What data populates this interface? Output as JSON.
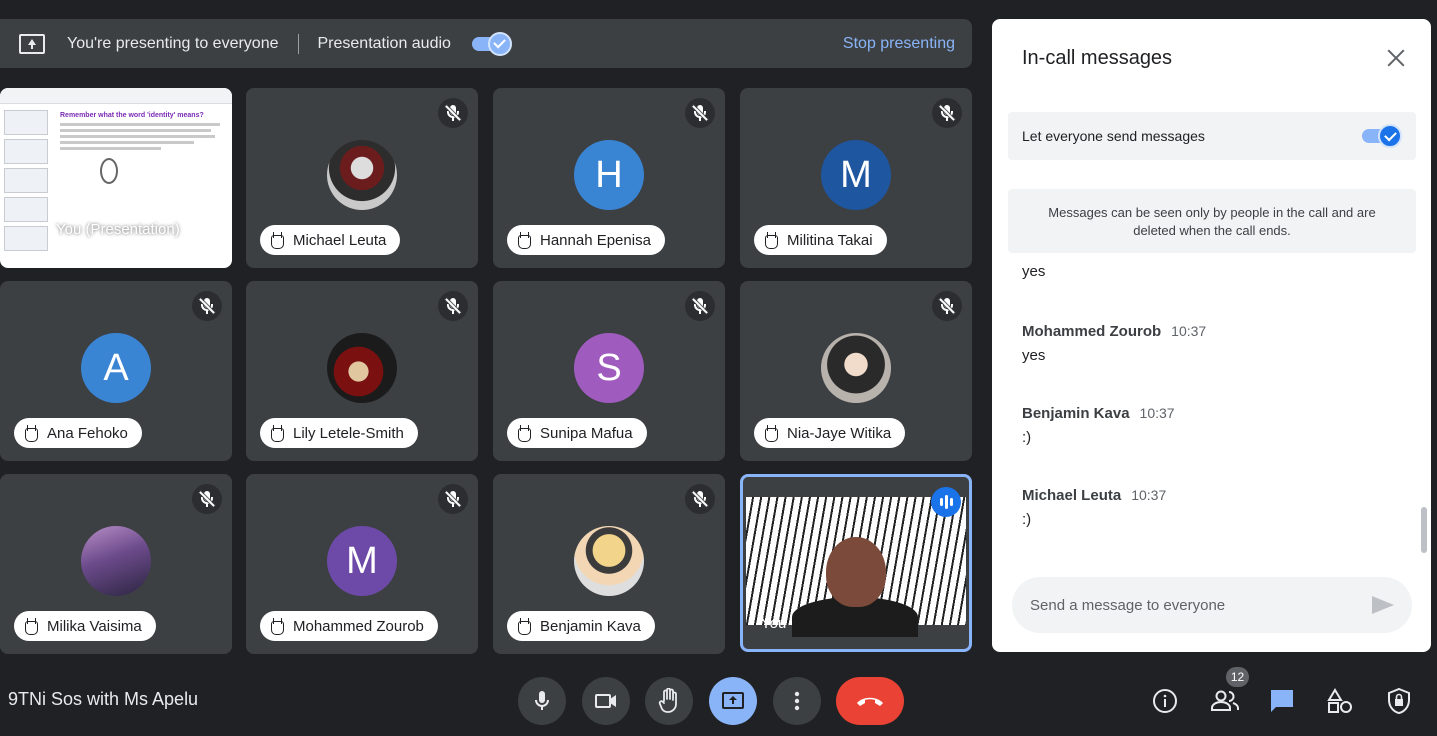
{
  "present_bar": {
    "text": "You're presenting to everyone",
    "audio_label": "Presentation audio",
    "stop_label": "Stop presenting"
  },
  "presentation_tile": {
    "label": "You (Presentation)",
    "slide_heading": "Remember what the word 'identity' means?"
  },
  "participants": [
    {
      "name": "Michael Leuta",
      "initial": ""
    },
    {
      "name": "Hannah Epenisa",
      "initial": "H",
      "color": "#3a84d4"
    },
    {
      "name": "Militina Takai",
      "initial": "M",
      "color": "#1e56a0"
    },
    {
      "name": "Ana Fehoko",
      "initial": "A",
      "color": "#3a84d4"
    },
    {
      "name": "Lily Letele-Smith",
      "initial": ""
    },
    {
      "name": "Sunipa Mafua",
      "initial": "S",
      "color": "#a05bbf"
    },
    {
      "name": "Nia-Jaye Witika",
      "initial": ""
    },
    {
      "name": "Milika Vaisima",
      "initial": ""
    },
    {
      "name": "Mohammed Zourob",
      "initial": "M",
      "color": "#6d4aa8"
    },
    {
      "name": "Benjamin Kava",
      "initial": ""
    }
  ],
  "self_tile": {
    "label": "You"
  },
  "chat": {
    "title": "In-call messages",
    "let_everyone": "Let everyone send messages",
    "info": "Messages can be seen only by people in the call and are deleted when the call ends.",
    "messages": [
      {
        "sender": "",
        "time": "",
        "text": "yes"
      },
      {
        "sender": "Mohammed Zourob",
        "time": "10:37",
        "text": "yes"
      },
      {
        "sender": "Benjamin Kava",
        "time": "10:37",
        "text": ":)"
      },
      {
        "sender": "Michael Leuta",
        "time": "10:37",
        "text": ":)"
      }
    ],
    "placeholder": "Send a message to everyone"
  },
  "meeting_name": "9TNi Sos with Ms Apelu",
  "people_count": "12",
  "colors": {
    "accent": "#8ab4f8",
    "end_call": "#ea4335",
    "tile_bg": "#3c4043"
  }
}
